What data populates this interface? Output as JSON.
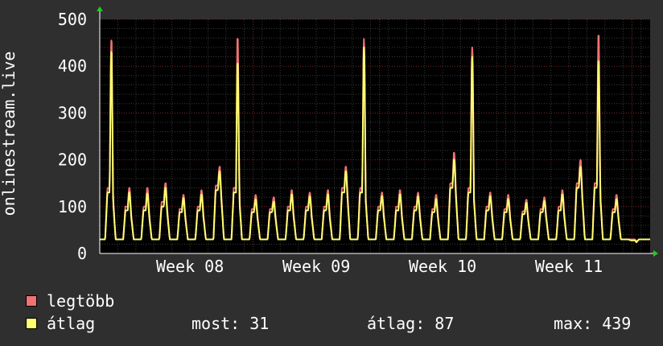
{
  "colors": {
    "background": "#2f2f2f",
    "plot_background": "#000000",
    "grid_major": "#7a2b2b",
    "grid_minor": "#3a3a3a",
    "axis": "#ffffff",
    "arrow": "#22cc22",
    "max_series": "#f07272",
    "avg_series": "#ffff73"
  },
  "chart_data": {
    "type": "line",
    "title": "",
    "ylabel": "onlinestream.live",
    "xlabel": "",
    "ylim": [
      0,
      500
    ],
    "yticks": [
      0,
      100,
      200,
      300,
      400,
      500
    ],
    "xtick_labels": [
      "Week 08",
      "Week 09",
      "Week 10",
      "Week 11"
    ],
    "x_unit": "days",
    "x_range_days": [
      0,
      30.5
    ],
    "xtick_days": [
      5,
      12,
      19,
      26
    ],
    "grid": true,
    "legend_placement": "bottom-left",
    "series": [
      {
        "name": "legtöbb",
        "color": "#f07272",
        "daily_peaks": [
          455,
          140,
          140,
          150,
          125,
          135,
          185,
          458,
          125,
          120,
          135,
          130,
          135,
          185,
          458,
          130,
          135,
          130,
          125,
          215,
          440,
          130,
          125,
          115,
          120,
          135,
          200,
          465,
          125,
          30
        ],
        "daily_shoulders": [
          140,
          100,
          100,
          110,
          95,
          100,
          145,
          140,
          95,
          95,
          100,
          100,
          100,
          140,
          140,
          100,
          100,
          100,
          95,
          150,
          140,
          100,
          95,
          90,
          95,
          100,
          150,
          150,
          95,
          30
        ]
      },
      {
        "name": "átlag",
        "color": "#ffff73",
        "daily_peaks": [
          430,
          130,
          128,
          140,
          118,
          126,
          175,
          405,
          116,
          110,
          126,
          122,
          126,
          175,
          440,
          122,
          126,
          122,
          116,
          200,
          420,
          122,
          116,
          108,
          112,
          126,
          185,
          410,
          116,
          28
        ],
        "daily_shoulders": [
          130,
          92,
          92,
          100,
          88,
          92,
          135,
          130,
          88,
          88,
          92,
          92,
          92,
          130,
          130,
          92,
          92,
          92,
          88,
          140,
          130,
          92,
          88,
          84,
          88,
          92,
          140,
          140,
          88,
          28
        ]
      }
    ]
  },
  "legend": {
    "items": [
      {
        "label": "legtöbb",
        "color": "#f07272"
      },
      {
        "label": "átlag",
        "color": "#ffff73"
      }
    ]
  },
  "stats": {
    "now": "most: 31",
    "avg": "átlag: 87",
    "max": "max: 439"
  }
}
